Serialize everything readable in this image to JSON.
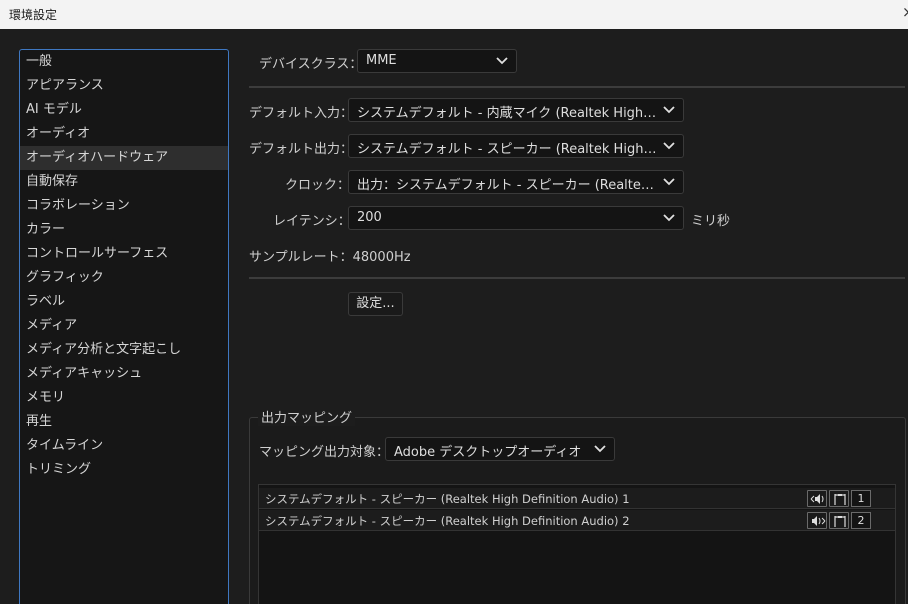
{
  "window": {
    "title": "環境設定",
    "close_glyph": "×"
  },
  "sidebar": {
    "items": [
      {
        "label": "一般"
      },
      {
        "label": "アピアランス"
      },
      {
        "label": "AI モデル"
      },
      {
        "label": "オーディオ"
      },
      {
        "label": "オーディオハードウェア",
        "selected": true
      },
      {
        "label": "自動保存"
      },
      {
        "label": "コラボレーション"
      },
      {
        "label": "カラー"
      },
      {
        "label": "コントロールサーフェス"
      },
      {
        "label": "グラフィック"
      },
      {
        "label": "ラベル"
      },
      {
        "label": "メディア"
      },
      {
        "label": "メディア分析と文字起こし"
      },
      {
        "label": "メディアキャッシュ"
      },
      {
        "label": "メモリ"
      },
      {
        "label": "再生"
      },
      {
        "label": "タイムライン"
      },
      {
        "label": "トリミング"
      }
    ]
  },
  "device_class": {
    "label": "デバイスクラス：",
    "value": "MME"
  },
  "default_input": {
    "label": "デフォルト入力：",
    "value": "システムデフォルト - 内蔵マイク (Realtek High Def..."
  },
  "default_output": {
    "label": "デフォルト出力：",
    "value": "システムデフォルト - スピーカー (Realtek High Def..."
  },
  "clock": {
    "label": "クロック：",
    "value": "出力：システムデフォルト - スピーカー (Realtek H..."
  },
  "latency": {
    "label": "レイテンシ：",
    "value": "200",
    "unit": "ミリ秒"
  },
  "sample_rate": {
    "text": "サンプルレート：48000Hz"
  },
  "settings_button": {
    "label": "設定..."
  },
  "output_mapping": {
    "title": "出力マッピング",
    "target_label": "マッピング出力対象：",
    "target_value": "Adobe デスクトップオーディオ",
    "rows": [
      {
        "name": "システムデフォルト - スピーカー (Realtek High Definition Audio) 1",
        "channel": "1"
      },
      {
        "name": "システムデフォルト - スピーカー (Realtek High Definition Audio) 2",
        "channel": "2"
      }
    ]
  },
  "icons": {
    "chevron": "chevron-down-icon",
    "speaker_left": "speaker-left-icon",
    "speaker_right": "speaker-right-icon",
    "frame": "channel-frame-icon"
  },
  "colors": {
    "focus_border": "#3f78c2",
    "background": "#1d1d1d"
  }
}
